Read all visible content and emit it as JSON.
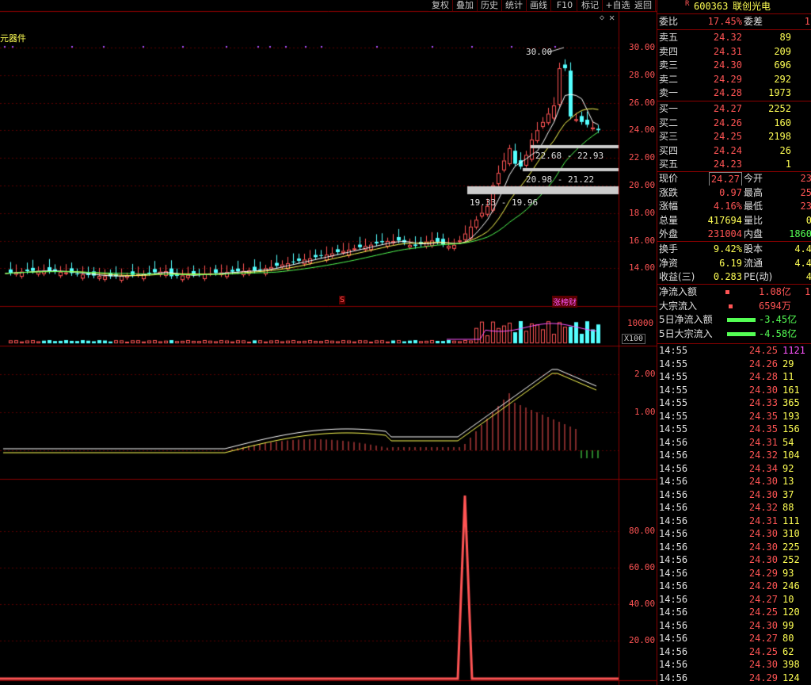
{
  "toolbar": [
    "复权",
    "叠加",
    "历史",
    "统计",
    "画线",
    "F10",
    "标记",
    "+自选",
    "返回"
  ],
  "stock": {
    "code": "600363",
    "name": "联创光电",
    "marker": "R"
  },
  "sector_label": "元器件",
  "price_labels": {
    "high": "30.00",
    "zone1": "22.68 - 22.93",
    "zone2": "20.98 - 21.22",
    "zone3": "19.33 - 19.96"
  },
  "badges": {
    "s": "S",
    "zhang": "涨榜财"
  },
  "main_axis": [
    "30.00",
    "28.00",
    "26.00",
    "24.00",
    "22.00",
    "20.00",
    "18.00",
    "16.00",
    "14.00"
  ],
  "vol_axis": {
    "top": "10000",
    "unit": "X100"
  },
  "macd_axis": [
    "2.00",
    "1.00"
  ],
  "ind_axis": [
    "80.00",
    "60.00",
    "40.00",
    "20.00"
  ],
  "order_book": {
    "ratio": {
      "label": "委比",
      "value": "17.45%",
      "label2": "委差",
      "value2": "1"
    },
    "asks": [
      {
        "label": "卖五",
        "price": "24.32",
        "vol": "89"
      },
      {
        "label": "卖四",
        "price": "24.31",
        "vol": "209"
      },
      {
        "label": "卖三",
        "price": "24.30",
        "vol": "696"
      },
      {
        "label": "卖二",
        "price": "24.29",
        "vol": "292"
      },
      {
        "label": "卖一",
        "price": "24.28",
        "vol": "1973"
      }
    ],
    "bids": [
      {
        "label": "买一",
        "price": "24.27",
        "vol": "2252"
      },
      {
        "label": "买二",
        "price": "24.26",
        "vol": "160"
      },
      {
        "label": "买三",
        "price": "24.25",
        "vol": "2198"
      },
      {
        "label": "买四",
        "price": "24.24",
        "vol": "26"
      },
      {
        "label": "买五",
        "price": "24.23",
        "vol": "1"
      }
    ]
  },
  "quote": [
    {
      "l1": "现价",
      "v1": "24.27",
      "l2": "今开",
      "v2": "23"
    },
    {
      "l1": "涨跌",
      "v1": "0.97",
      "l2": "最高",
      "v2": "25"
    },
    {
      "l1": "涨幅",
      "v1": "4.16%",
      "l2": "最低",
      "v2": "23"
    },
    {
      "l1": "总量",
      "v1": "417694",
      "l2": "量比",
      "v2": "0"
    },
    {
      "l1": "外盘",
      "v1": "231004",
      "l2": "内盘",
      "v2": "1860"
    }
  ],
  "fundamentals": [
    {
      "l1": "换手",
      "v1": "9.42%",
      "l2": "股本",
      "v2": "4.4"
    },
    {
      "l1": "净资",
      "v1": "6.19",
      "l2": "流通",
      "v2": "4.4"
    },
    {
      "l1": "收益(三)",
      "v1": "0.283",
      "l2": "PE(动)",
      "v2": "4"
    }
  ],
  "flows": [
    {
      "label": "净流入额",
      "value": "1.08亿",
      "extra": "1"
    },
    {
      "label": "大宗流入",
      "value": "6594万",
      "extra": ""
    },
    {
      "label": "5日净流入额",
      "value": "-3.45亿",
      "extra": ""
    },
    {
      "label": "5日大宗流入",
      "value": "-4.58亿",
      "extra": ""
    }
  ],
  "ticks": [
    [
      "14:55",
      "24.25",
      "1121"
    ],
    [
      "14:55",
      "24.26",
      "29"
    ],
    [
      "14:55",
      "24.28",
      "11"
    ],
    [
      "14:55",
      "24.30",
      "161"
    ],
    [
      "14:55",
      "24.33",
      "365"
    ],
    [
      "14:55",
      "24.35",
      "193"
    ],
    [
      "14:55",
      "24.35",
      "156"
    ],
    [
      "14:56",
      "24.31",
      "54"
    ],
    [
      "14:56",
      "24.32",
      "104"
    ],
    [
      "14:56",
      "24.34",
      "92"
    ],
    [
      "14:56",
      "24.30",
      "13"
    ],
    [
      "14:56",
      "24.30",
      "37"
    ],
    [
      "14:56",
      "24.32",
      "88"
    ],
    [
      "14:56",
      "24.31",
      "111"
    ],
    [
      "14:56",
      "24.30",
      "310"
    ],
    [
      "14:56",
      "24.30",
      "225"
    ],
    [
      "14:56",
      "24.30",
      "252"
    ],
    [
      "14:56",
      "24.29",
      "93"
    ],
    [
      "14:56",
      "24.20",
      "246"
    ],
    [
      "14:56",
      "24.27",
      "10"
    ],
    [
      "14:56",
      "24.25",
      "120"
    ],
    [
      "14:56",
      "24.30",
      "99"
    ],
    [
      "14:56",
      "24.27",
      "80"
    ],
    [
      "14:56",
      "24.25",
      "62"
    ],
    [
      "14:56",
      "24.30",
      "398"
    ],
    [
      "14:56",
      "24.29",
      "124"
    ]
  ],
  "colors": {
    "up": "#ff5454",
    "down": "#54ffff",
    "ma5": "#ffffff",
    "ma10": "#ffff54",
    "ma20": "#54ff54",
    "grid": "#8a0000"
  }
}
